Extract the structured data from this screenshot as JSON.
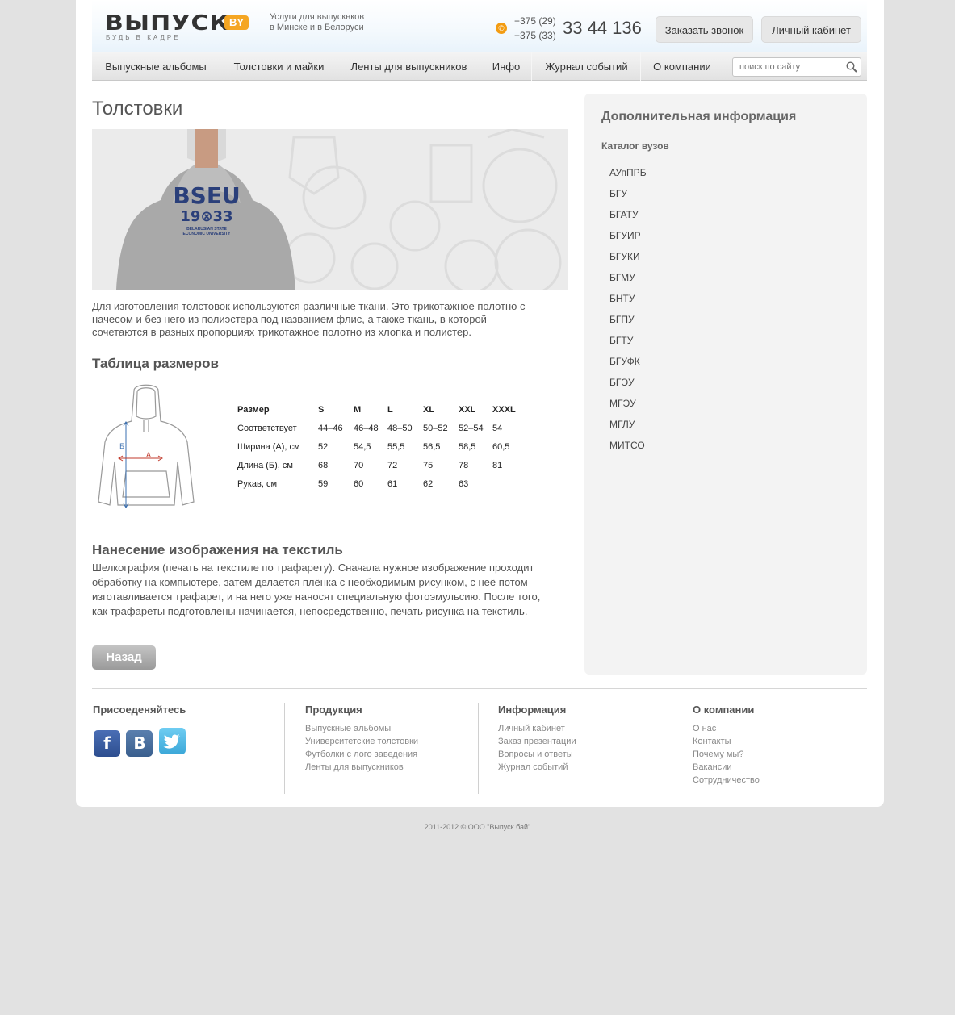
{
  "header": {
    "logo_text": "ВЫПУСК",
    "logo_badge": "BY",
    "logo_tagline": "БУДЬ В КАДРЕ",
    "services_line1": "Услуги для выпускнков",
    "services_line2": "в Минске и в Белоруси",
    "phone_code1": "+375 (29)",
    "phone_code2": "+375 (33)",
    "phone_number": "33 44 136",
    "callback_button": "Заказать звонок",
    "account_button": "Личный кабинет"
  },
  "nav": {
    "items": [
      "Выпускные альбомы",
      "Толстовки и майки",
      "Ленты для выпускников",
      "Инфо",
      "Журнал событий",
      "О компании"
    ],
    "search_placeholder": "поиск по сайту"
  },
  "main": {
    "title": "Толстовки",
    "banner_print": {
      "name": "BSEU",
      "year": "19⊗33",
      "line1": "BELARUSIAN STATE",
      "line2": "ECONOMIC UNIVERSITY"
    },
    "intro": "Для изготовления толстовок используются различные ткани. Это трикотажное полотно с начесом и без него из полиэстера под названием флис, а также ткань, в которой сочетаются в разных пропорциях трикотажное полотно из хлопка и полистер.",
    "size_table_title": "Таблица размеров",
    "diagram_labels": {
      "length": "Б",
      "width": "А"
    },
    "size_table": {
      "headers": [
        "Размер",
        "S",
        "M",
        "L",
        "XL",
        "XXL",
        "XXXL"
      ],
      "rows": [
        [
          "Соответствует",
          "44–46",
          "46–48",
          "48–50",
          "50–52",
          "52–54",
          "54"
        ],
        [
          "Ширина (А), см",
          "52",
          "54,5",
          "55,5",
          "56,5",
          "58,5",
          "60,5"
        ],
        [
          "Длина (Б), см",
          "68",
          "70",
          "72",
          "75",
          "78",
          "81"
        ],
        [
          "Рукав, см",
          "59",
          "60",
          "61",
          "62",
          "63",
          ""
        ]
      ]
    },
    "print_title": "Нанесение изображения на текстиль",
    "print_text": "Шелкография (печать на текстиле по трафарету). Сначала нужное изображение проходит обработку на компьютере, затем делается плёнка с необходимым рисунком, с неё потом изготавливается трафарет, и на него уже наносят специальную фотоэмульсию. После того, как трафареты подготовлены начинается, непосредственно, печать рисунка на текстиль.",
    "back_button": "Назад"
  },
  "sidebar": {
    "title": "Дополнительная информация",
    "subtitle": "Каталог вузов",
    "universities": [
      "АУпПРБ",
      "БГУ",
      "БГАТУ",
      "БГУИР",
      "БГУКИ",
      "БГМУ",
      "БНТУ",
      "БГПУ",
      "БГТУ",
      "БГУФК",
      "БГЭУ",
      "МГЭУ",
      "МГЛУ",
      "МИТСО"
    ]
  },
  "footer": {
    "join_title": "Присоеденяйтесь",
    "social": {
      "facebook": "f",
      "vkontakte": "В"
    },
    "products": {
      "title": "Продукция",
      "links": [
        "Выпускные альбомы",
        "Университетские толстовки",
        "Футболки с лого заведения",
        "Ленты для выпускников"
      ]
    },
    "info": {
      "title": "Информация",
      "links": [
        "Личный кабинет",
        "Заказ презентации",
        "Вопросы и ответы",
        "Журнал событий"
      ]
    },
    "company": {
      "title": "О компании",
      "links": [
        "О нас",
        "Контакты",
        "Почему мы?",
        "Вакансии",
        "Сотрудничество"
      ]
    },
    "copyright": "2011-2012  ©  ООО \"Выпуск.бай\""
  }
}
